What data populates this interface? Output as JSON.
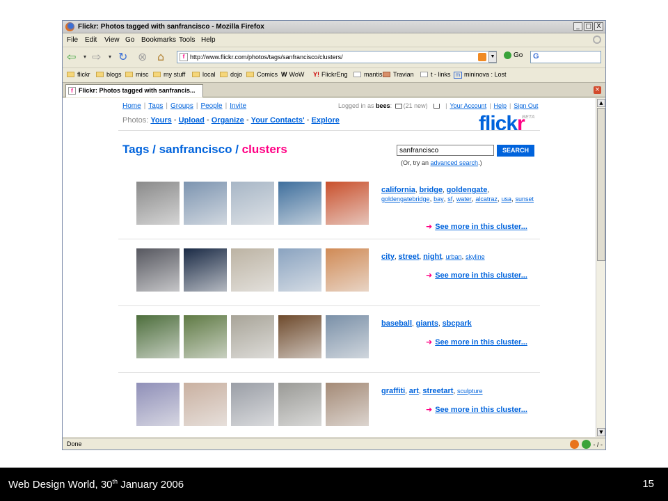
{
  "window": {
    "title": "Flickr: Photos tagged with sanfrancisco - Mozilla Firefox",
    "buttons": [
      "_",
      "□",
      "X"
    ]
  },
  "menu": [
    "File",
    "Edit",
    "View",
    "Go",
    "Bookmarks",
    "Tools",
    "Help"
  ],
  "nav": {
    "url": "http://www.flickr.com/photos/tags/sanfrancisco/clusters/",
    "go_label": "Go"
  },
  "bookmarks": [
    "flickr",
    "blogs",
    "misc",
    "my stuff",
    "local",
    "dojo",
    "Comics",
    "WoW",
    "FlickrEng",
    "mantis",
    "Travian",
    "t - links",
    "mininova : Lost"
  ],
  "tab": {
    "label": "Flickr: Photos tagged with sanfrancis..."
  },
  "status": {
    "text": "Done",
    "right": "- / -"
  },
  "flickr": {
    "topnav": [
      "Home",
      "Tags",
      "Groups",
      "People",
      "Invite"
    ],
    "logged_in_prefix": "Logged in as",
    "username": "bees",
    "new_count": "(21 new)",
    "account_links": [
      "Your Account",
      "Help",
      "Sign Out"
    ],
    "photos_label": "Photos:",
    "photos_links": [
      "Yours",
      "Upload",
      "Organize",
      "Your Contacts'",
      "Explore"
    ],
    "logo": {
      "blue": "flick",
      "pink": "r",
      "beta": "BETA"
    },
    "heading": {
      "tags": "Tags",
      "sep1": " / ",
      "tag": "sanfrancisco",
      "sep2": " / ",
      "clusters": "clusters"
    },
    "search": {
      "value": "sanfrancisco",
      "button": "SEARCH",
      "hint_prefix": "(Or, try an ",
      "hint_link": "advanced search",
      "hint_suffix": ".)"
    },
    "clusters": [
      {
        "big_tags": [
          "california",
          "bridge",
          "goldengate"
        ],
        "small_tags": [
          "goldengatebridge",
          "bay",
          "sf",
          "water",
          "alcatraz",
          "usa",
          "sunset"
        ],
        "more": "See more in this cluster...",
        "photo_colors": [
          "#8a8a8a",
          "#7c94b0",
          "#a7b6c6",
          "#3f6f9d",
          "#c9502c"
        ]
      },
      {
        "big_tags": [
          "city",
          "street",
          "night"
        ],
        "small_tags": [
          "urban",
          "skyline"
        ],
        "more": "See more in this cluster...",
        "photo_colors": [
          "#56575f",
          "#1a2a45",
          "#bcb3a3",
          "#8aa3c0",
          "#d08a55"
        ]
      },
      {
        "big_tags": [
          "baseball",
          "giants",
          "sbcpark"
        ],
        "small_tags": [],
        "more": "See more in this cluster...",
        "photo_colors": [
          "#4d6e3c",
          "#5f7a44",
          "#a8a498",
          "#6e4a2c",
          "#7a90a8"
        ]
      },
      {
        "big_tags": [
          "graffiti",
          "art",
          "streetart"
        ],
        "small_tags": [
          "sculpture"
        ],
        "more": "See more in this cluster...",
        "photo_colors": [
          "#8f8fb8",
          "#c9b0a0",
          "#9a9ea6",
          "#9a9a96",
          "#a48a76"
        ]
      }
    ]
  },
  "footer": {
    "text_prefix": "Web Design World, 30",
    "text_sup": "th",
    "text_suffix": " January 2006",
    "page": "15"
  }
}
